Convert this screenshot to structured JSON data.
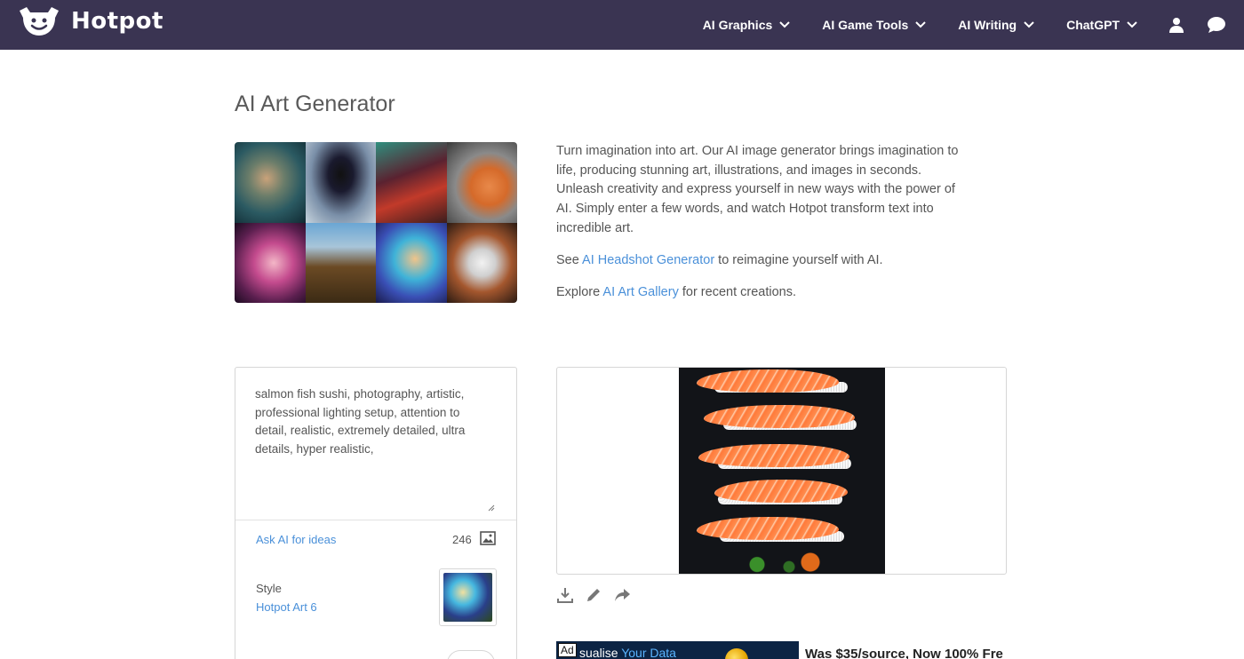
{
  "nav": {
    "brand": "Hotpot",
    "items": [
      {
        "label": "AI Graphics"
      },
      {
        "label": "AI Game Tools"
      },
      {
        "label": "AI Writing"
      },
      {
        "label": "ChatGPT"
      }
    ]
  },
  "header": {
    "title": "AI Art Generator"
  },
  "intro": {
    "paragraph": "Turn imagination into art. Our AI image generator brings imagination to life, producing stunning art, illustrations, and images in seconds. Unleash creativity and express yourself in new ways with the power of AI. Simply enter a few words, and watch Hotpot transform text into incredible art.",
    "see_prefix": "See ",
    "see_link": "AI Headshot Generator",
    "see_suffix": " to reimagine yourself with AI.",
    "explore_prefix": "Explore ",
    "explore_link": "AI Art Gallery",
    "explore_suffix": " for recent creations."
  },
  "form": {
    "prompt": "salmon fish sushi, photography, artistic, professional lighting setup, attention to detail, realistic, extremely detailed, ultra details, hyper realistic,",
    "ask_ai": "Ask AI for ideas",
    "char_count": "246",
    "style_label": "Style",
    "style_value": "Hotpot Art 6"
  },
  "ad": {
    "badge": "Ad",
    "text_prefix": "sualise ",
    "text_highlight": "Your Data",
    "side_text": "Was $35/source, Now 100% Fre"
  },
  "colors": {
    "nav_bg": "#3a3452",
    "link": "#4a90d9",
    "text": "#555555"
  }
}
